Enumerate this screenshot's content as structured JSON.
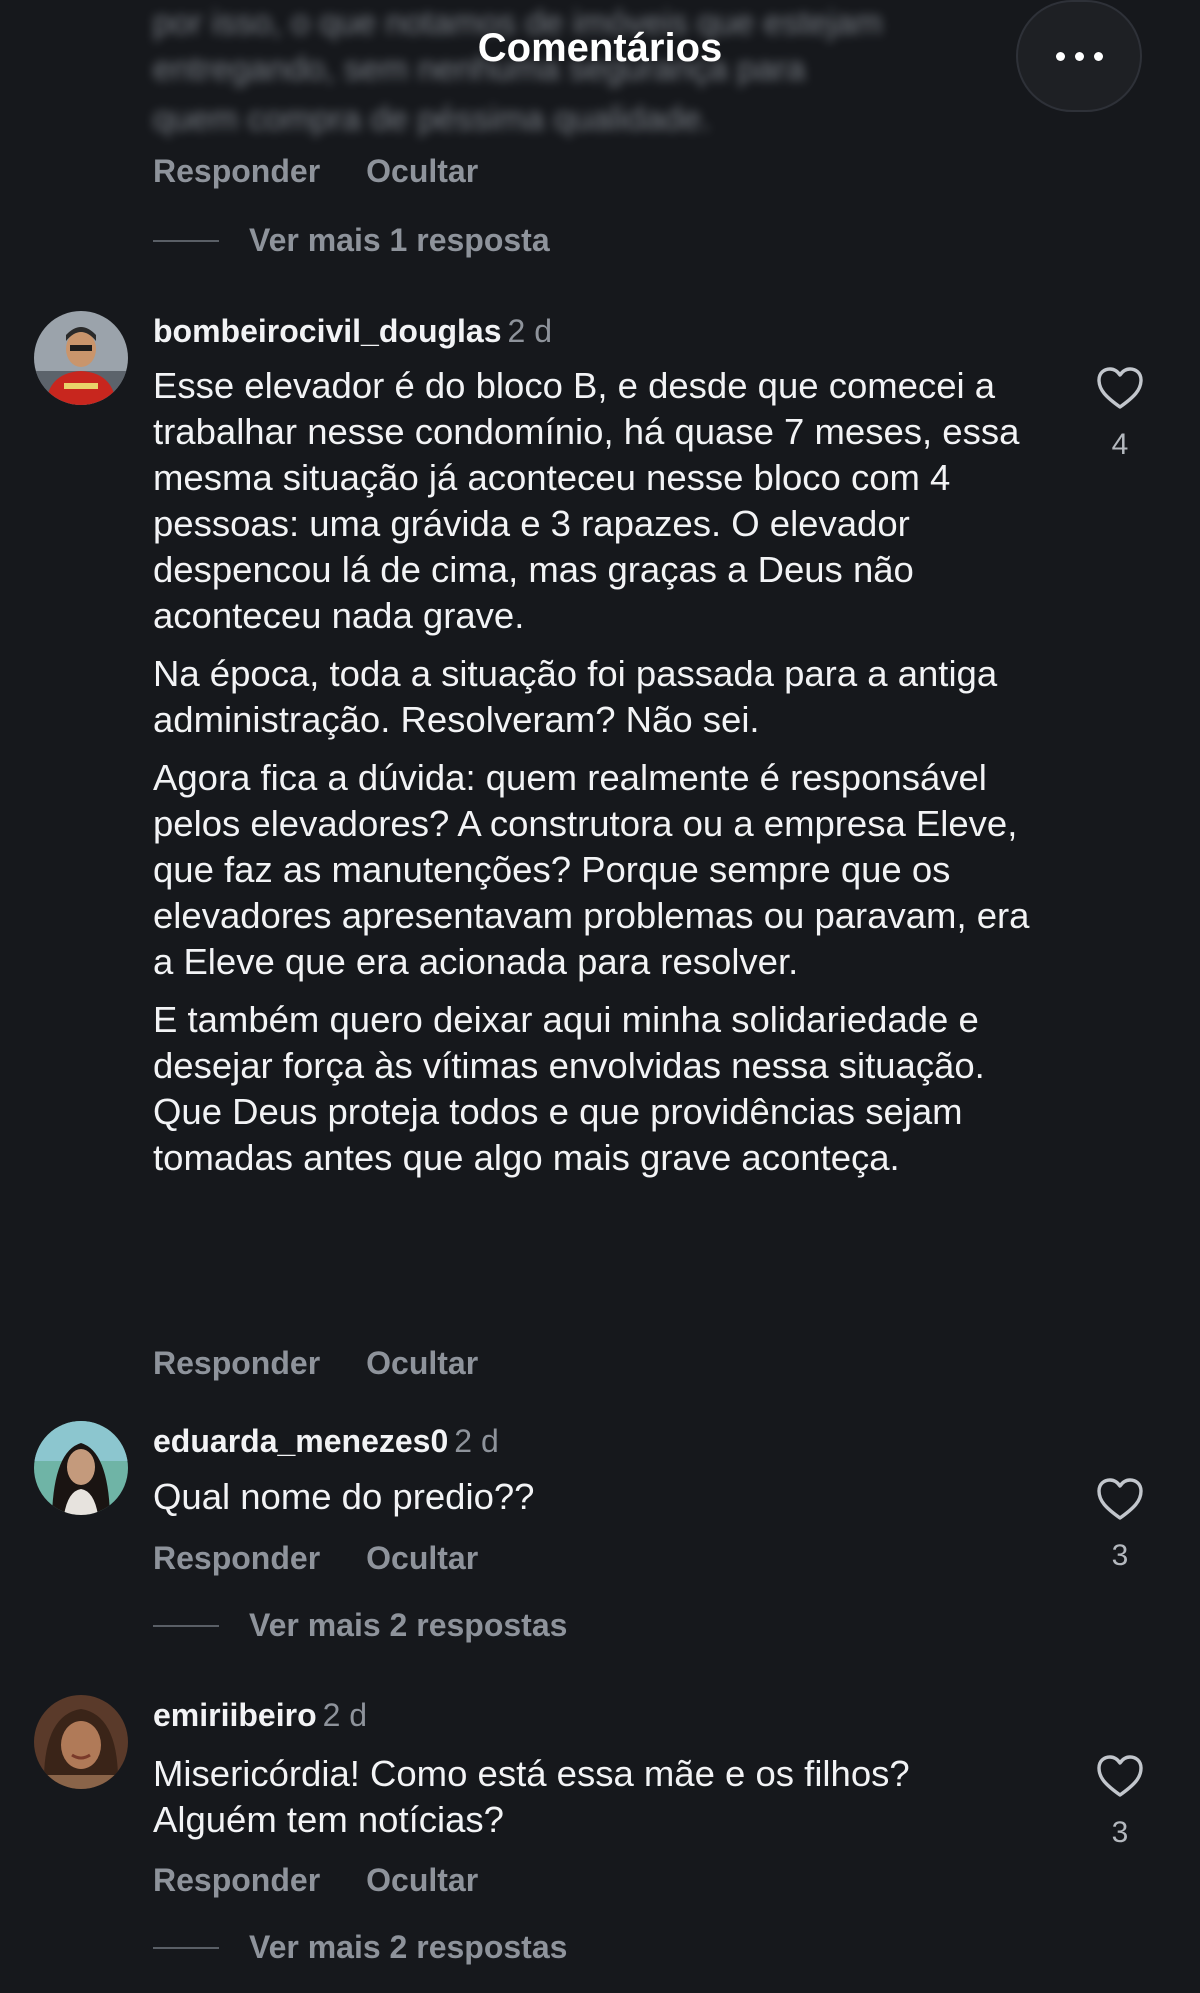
{
  "header": {
    "title": "Comentários",
    "more_label": "•••"
  },
  "previous_comment": {
    "blurred_lines": [
      "por isso, o que notamos de imóveis que estejam",
      "entregando, sem nenhuma segurança para",
      "quem compra de péssima qualidade."
    ],
    "reply_label": "Responder",
    "hide_label": "Ocultar",
    "view_replies": "Ver mais 1 resposta"
  },
  "comments": [
    {
      "username": "bombeirocivil_douglas",
      "time": "2 d",
      "paragraphs": [
        "Esse elevador é do bloco B, e desde que comecei a trabalhar nesse condomínio, há quase 7 meses, essa mesma situação já aconteceu nesse bloco com 4 pessoas: uma grávida e 3 rapazes. O elevador despencou lá de cima, mas graças a Deus não aconteceu nada grave.",
        "Na época, toda a situação foi passada para a antiga administração. Resolveram? Não sei.",
        "Agora fica a dúvida: quem realmente é responsável pelos elevadores? A construtora ou a empresa Eleve, que faz as manutenções? Porque sempre que os elevadores apresentavam problemas ou paravam, era a Eleve que era acionada para resolver.",
        "E também quero deixar aqui minha solidariedade e desejar força às vítimas envolvidas nessa situação. Que Deus proteja todos e que providências sejam tomadas antes que algo mais grave aconteça."
      ],
      "likes": "4",
      "reply_label": "Responder",
      "hide_label": "Ocultar"
    },
    {
      "username": "eduarda_menezes0",
      "time": "2 d",
      "paragraphs": [
        "Qual nome do predio??"
      ],
      "likes": "3",
      "reply_label": "Responder",
      "hide_label": "Ocultar",
      "view_replies": "Ver mais 2 respostas"
    },
    {
      "username": "emiriibeiro",
      "time": "2 d",
      "paragraphs": [
        "Misericórdia! Como está essa mãe e os filhos? Alguém tem notícias?"
      ],
      "likes": "3",
      "reply_label": "Responder",
      "hide_label": "Ocultar",
      "view_replies": "Ver mais 2 respostas"
    }
  ]
}
